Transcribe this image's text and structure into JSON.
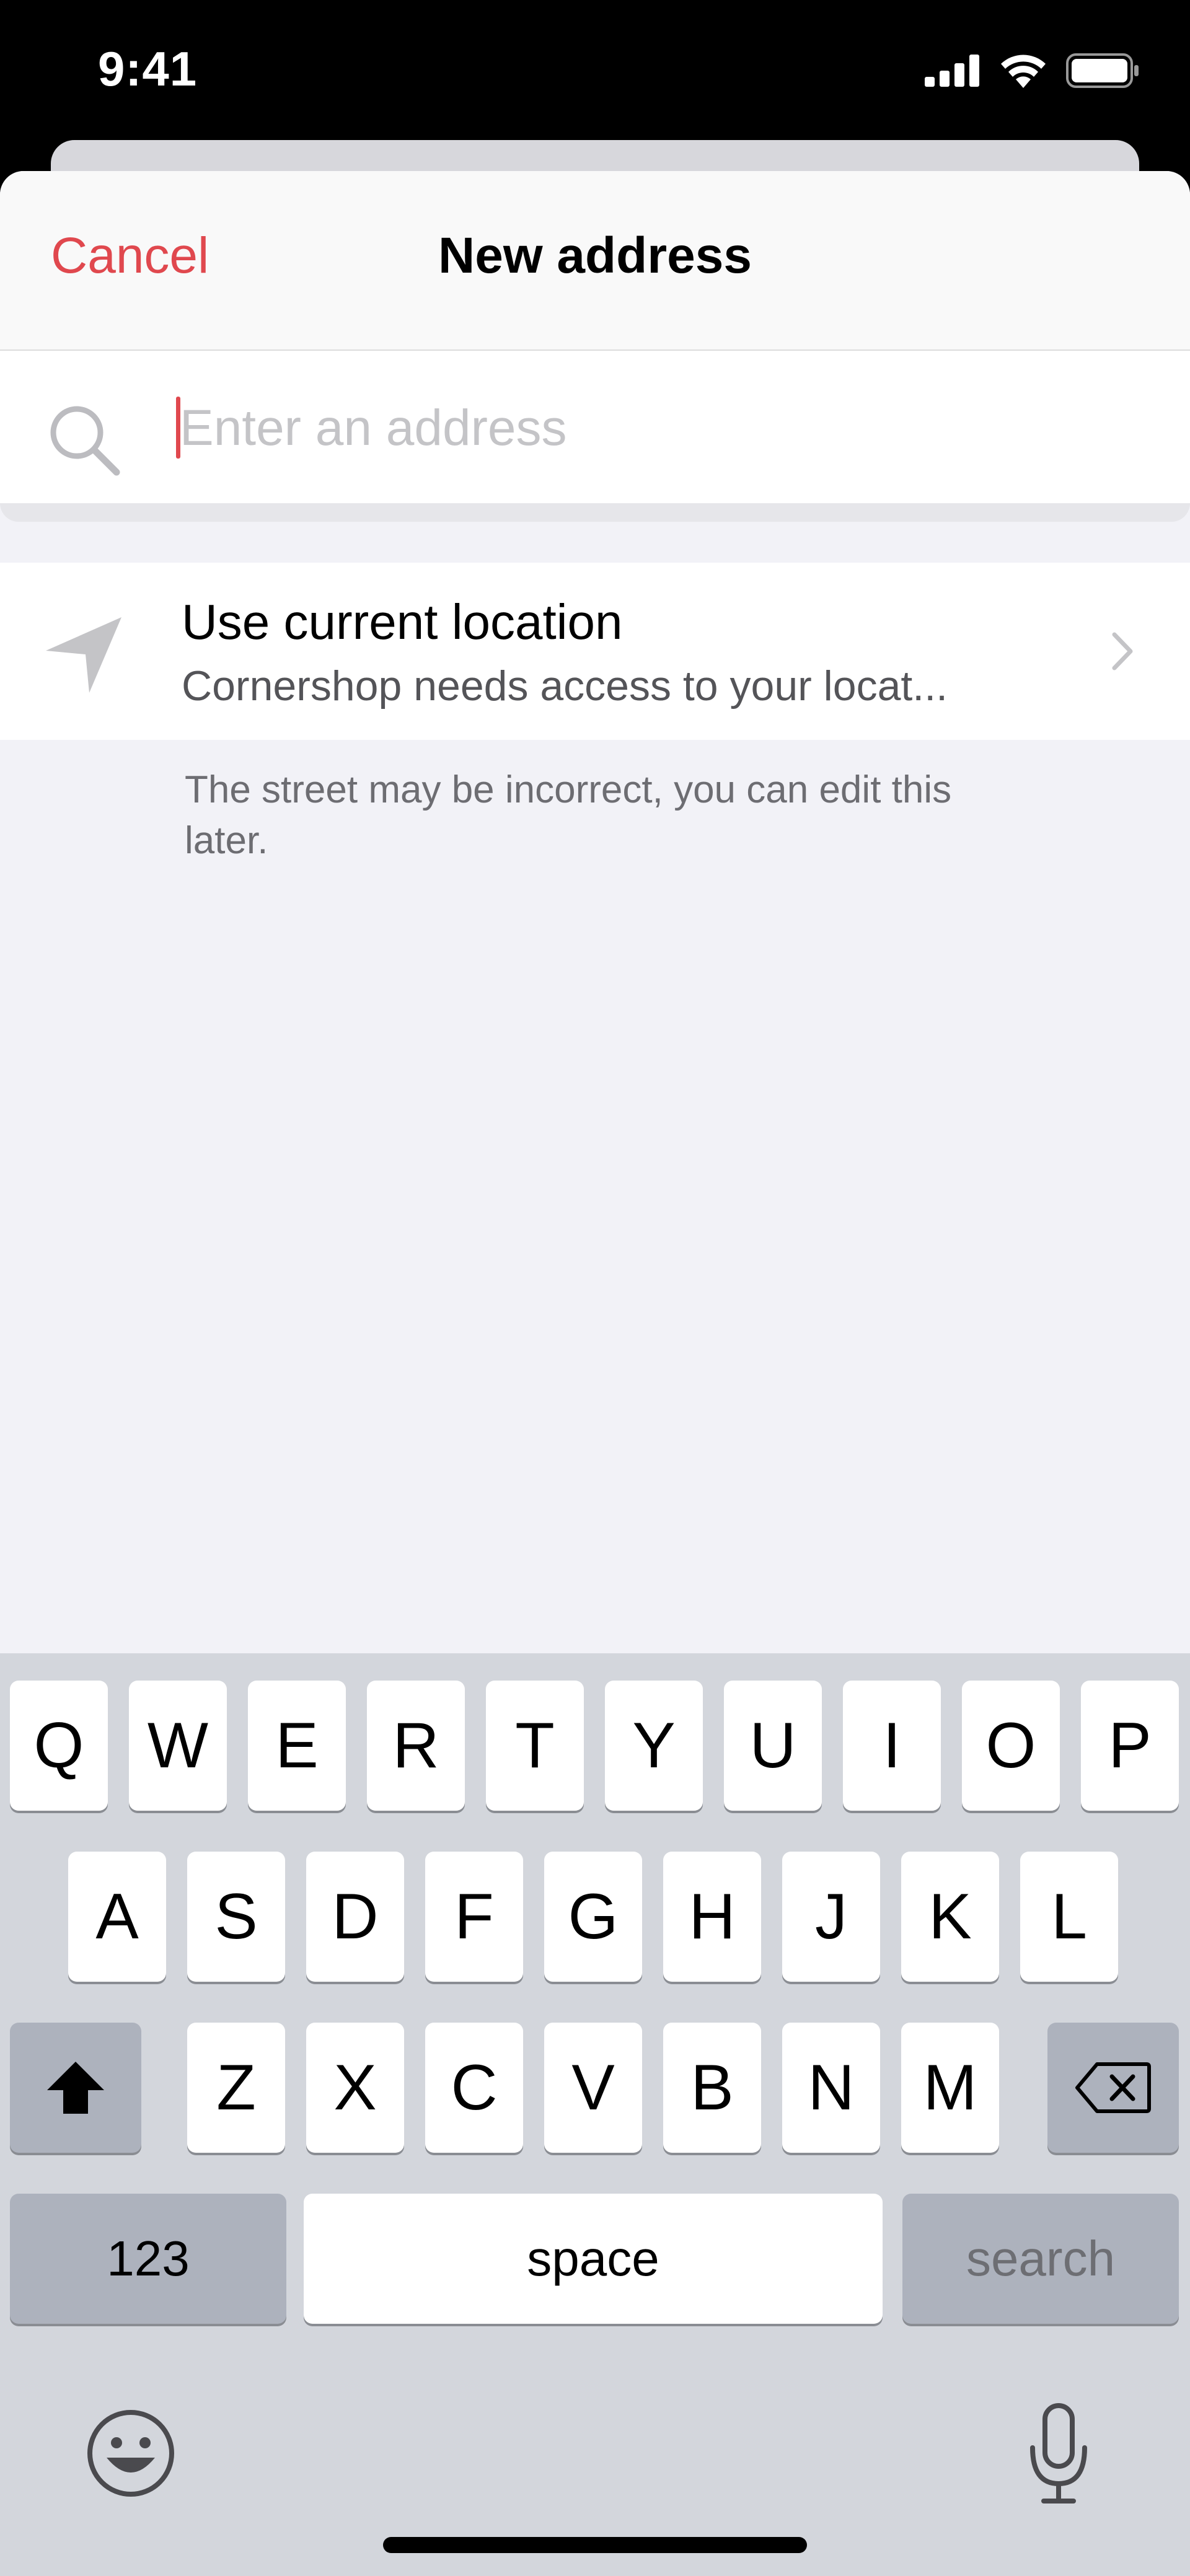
{
  "status_bar": {
    "time": "9:41",
    "icons": [
      "signal-icon",
      "wifi-icon",
      "battery-icon"
    ]
  },
  "nav": {
    "cancel_label": "Cancel",
    "title": "New address"
  },
  "search": {
    "placeholder": "Enter an address",
    "value": ""
  },
  "location_option": {
    "title": "Use current location",
    "subtitle": "Cornershop needs access to your locat..."
  },
  "note": "The street may be incorrect, you can edit this later.",
  "keyboard": {
    "rows": [
      [
        "Q",
        "W",
        "E",
        "R",
        "T",
        "Y",
        "U",
        "I",
        "O",
        "P"
      ],
      [
        "A",
        "S",
        "D",
        "F",
        "G",
        "H",
        "J",
        "K",
        "L"
      ],
      [
        "Z",
        "X",
        "C",
        "V",
        "B",
        "N",
        "M"
      ]
    ],
    "numbers_label": "123",
    "space_label": "space",
    "search_label": "search"
  },
  "colors": {
    "accent": "#e0484e",
    "background": "#f2f2f7",
    "keyboard": "#d3d6dc"
  }
}
